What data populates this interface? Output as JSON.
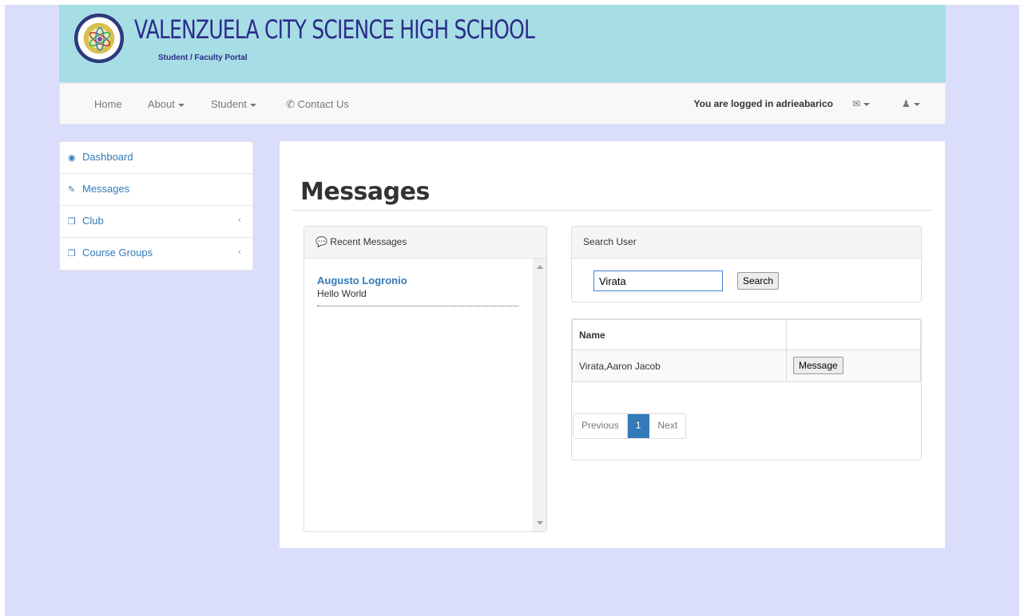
{
  "header": {
    "school_name": "VALENZUELA CITY SCIENCE HIGH SCHOOL",
    "portal_label": "Student / Faculty Portal"
  },
  "navbar": {
    "items": [
      {
        "label": "Home"
      },
      {
        "label": "About"
      },
      {
        "label": "Student"
      },
      {
        "label": "Contact Us",
        "icon": "phone-icon"
      }
    ],
    "logged_in_text": "You are logged in adrieabarico",
    "mail_icon": "envelope-icon",
    "user_icon": "user-icon"
  },
  "sidebar": {
    "items": [
      {
        "label": "Dashboard",
        "icon": "dashboard-icon"
      },
      {
        "label": "Messages",
        "icon": "edit-icon"
      },
      {
        "label": "Club",
        "icon": "copy-icon"
      },
      {
        "label": "Course Groups",
        "icon": "copy-icon"
      }
    ]
  },
  "main": {
    "title": "Messages",
    "recent": {
      "heading": "Recent Messages",
      "messages": [
        {
          "from": "Augusto Logronio",
          "text": "Hello World"
        }
      ]
    },
    "search": {
      "heading": "Search User",
      "value": "Virata",
      "button": "Search"
    },
    "results": {
      "columns": [
        "Name",
        ""
      ],
      "rows": [
        {
          "name": "Virata,Aaron Jacob",
          "action": "Message"
        }
      ]
    },
    "pagination": {
      "previous": "Previous",
      "current": "1",
      "next": "Next"
    }
  },
  "colors": {
    "banner": "#a7dde5",
    "page_background": "#dadefb",
    "link": "#337ab7",
    "title_text": "#2c2c8a"
  }
}
